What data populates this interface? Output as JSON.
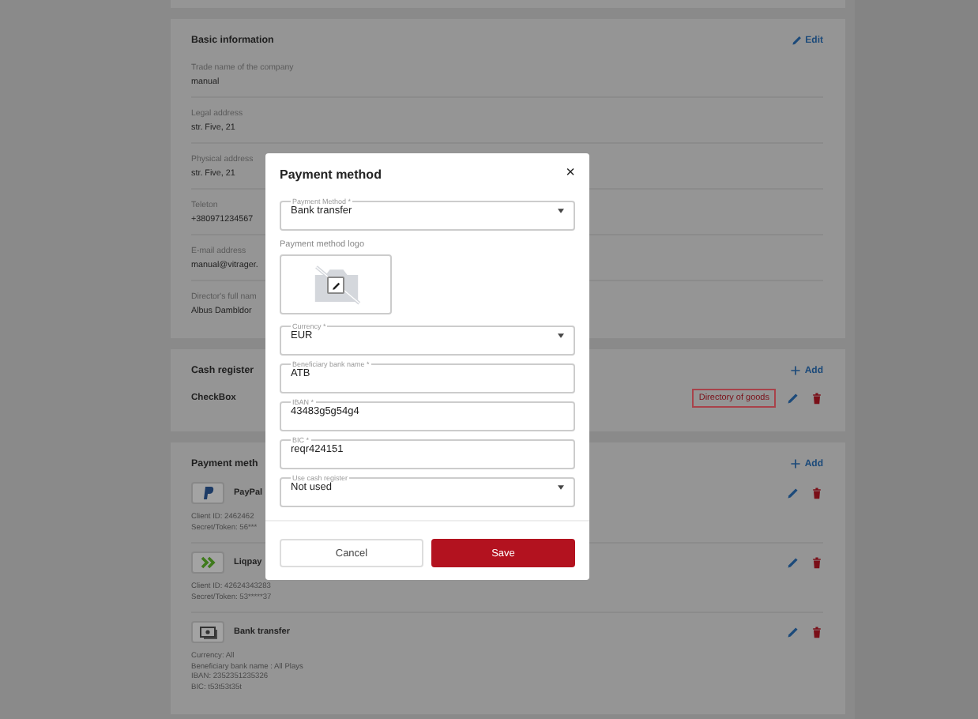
{
  "basic_information": {
    "title": "Basic information",
    "edit_link": "Edit",
    "fields": [
      {
        "label": "Trade name of the company",
        "value": "manual"
      },
      {
        "label": "Legal address",
        "value": "str. Five, 21"
      },
      {
        "label": "Physical address",
        "value": "str. Five, 21"
      },
      {
        "label": "Teleton",
        "value": "+380971234567"
      },
      {
        "label": "E-mail address",
        "value": "manual@vitrager."
      },
      {
        "label": "Director's full nam",
        "value": "Albus Dambldor"
      }
    ]
  },
  "cash_register": {
    "title": "Cash register",
    "add_link": "Add",
    "items": [
      {
        "name": "CheckBox",
        "tag": "Directory of goods"
      }
    ]
  },
  "payment_methods": {
    "title": "Payment meth",
    "add_link": "Add",
    "items": [
      {
        "kind": "paypal",
        "name": "PayPal",
        "details": [
          "Client ID: 2462462",
          "Secret/Token: 56***"
        ]
      },
      {
        "kind": "liqpay",
        "name": "Liqpay",
        "details": [
          "Client ID: 42624343283",
          "Secret/Token: 53*****37"
        ]
      },
      {
        "kind": "bank",
        "name": "Bank transfer",
        "details": [
          "Currency: All",
          "Beneficiary bank name : All Plays",
          "IBAN: 2352351235326",
          "BIC: t53t53t35t"
        ]
      }
    ]
  },
  "dialog": {
    "title": "Payment method",
    "close": "×",
    "fields": [
      {
        "kind": "select",
        "label": "Payment Method *",
        "value": "Bank transfer"
      },
      {
        "kind": "logo",
        "label": "Payment method logo"
      },
      {
        "kind": "select",
        "label": "Currency *",
        "value": "EUR"
      },
      {
        "kind": "input",
        "label": "Beneficiary bank name *",
        "value": "ATB"
      },
      {
        "kind": "input",
        "label": "IBAN *",
        "value": "43483g5g54g4"
      },
      {
        "kind": "input",
        "label": "BIC *",
        "value": "reqr424151"
      },
      {
        "kind": "select",
        "label": "Use cash register",
        "value": "Not used"
      }
    ],
    "buttons": [
      {
        "kind": "secondary",
        "label": "Cancel"
      },
      {
        "kind": "primary",
        "label": "Save"
      }
    ]
  }
}
